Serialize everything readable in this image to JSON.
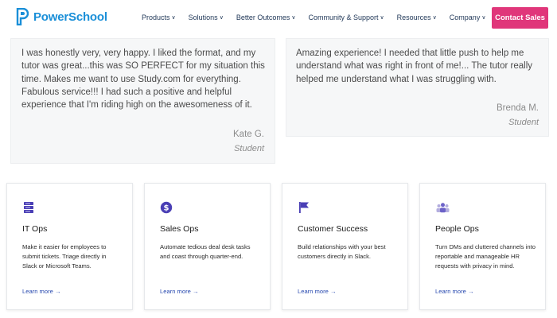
{
  "brand": {
    "name": "PowerSchool",
    "color": "#1a8fd8"
  },
  "nav": {
    "items": [
      {
        "label": "Products"
      },
      {
        "label": "Solutions"
      },
      {
        "label": "Better Outcomes"
      },
      {
        "label": "Community & Support"
      },
      {
        "label": "Resources"
      },
      {
        "label": "Company"
      }
    ],
    "contact_label": "Contact Sales",
    "contact_color": "#e0367a"
  },
  "testimonials": [
    {
      "quote": "I was honestly very, very happy. I liked the format, and my tutor was great...this was SO PERFECT for my situation this time. Makes me want to use Study.com for everything. Fabulous service!!! I had such a positive and helpful experience that I'm riding high on the awesomeness of it.",
      "name": "Kate G.",
      "role": "Student"
    },
    {
      "quote": "Amazing experience! I needed that little push to help me understand what was right in front of me!... The tutor really helped me understand what I was struggling with.",
      "name": "Brenda M.",
      "role": "Student"
    }
  ],
  "cards": [
    {
      "icon": "server-stack-icon",
      "title": "IT Ops",
      "desc": "Make it easier for employees to submit tickets. Triage directly in Slack or Microsoft Teams.",
      "link": "Learn more →"
    },
    {
      "icon": "dollar-coin-icon",
      "title": "Sales Ops",
      "desc": "Automate tedious deal desk tasks and coast through quarter-end.",
      "link": "Learn more →"
    },
    {
      "icon": "flag-icon",
      "title": "Customer Success",
      "desc": "Build relationships with your best customers directly in Slack.",
      "link": "Learn more →"
    },
    {
      "icon": "people-group-icon",
      "title": "People Ops",
      "desc": "Turn DMs and cluttered channels into reportable and manageable HR requests with privacy in mind.",
      "link": "Learn more →"
    }
  ],
  "colors": {
    "icon_accent": "#4a3fb5",
    "people_icon": "#8a82d8",
    "link": "#2a4bb0"
  }
}
